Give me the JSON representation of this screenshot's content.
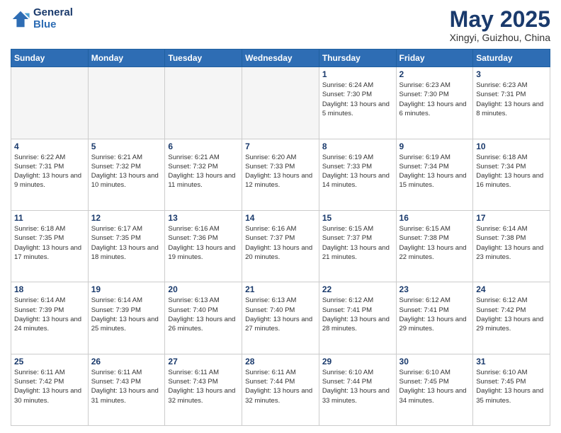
{
  "header": {
    "logo_line1": "General",
    "logo_line2": "Blue",
    "month_year": "May 2025",
    "location": "Xingyi, Guizhou, China"
  },
  "days_of_week": [
    "Sunday",
    "Monday",
    "Tuesday",
    "Wednesday",
    "Thursday",
    "Friday",
    "Saturday"
  ],
  "weeks": [
    [
      {
        "day": "",
        "empty": true
      },
      {
        "day": "",
        "empty": true
      },
      {
        "day": "",
        "empty": true
      },
      {
        "day": "",
        "empty": true
      },
      {
        "day": "1",
        "sunrise": "6:24 AM",
        "sunset": "7:30 PM",
        "daylight": "13 hours and 5 minutes."
      },
      {
        "day": "2",
        "sunrise": "6:23 AM",
        "sunset": "7:30 PM",
        "daylight": "13 hours and 6 minutes."
      },
      {
        "day": "3",
        "sunrise": "6:23 AM",
        "sunset": "7:31 PM",
        "daylight": "13 hours and 8 minutes."
      }
    ],
    [
      {
        "day": "4",
        "sunrise": "6:22 AM",
        "sunset": "7:31 PM",
        "daylight": "13 hours and 9 minutes."
      },
      {
        "day": "5",
        "sunrise": "6:21 AM",
        "sunset": "7:32 PM",
        "daylight": "13 hours and 10 minutes."
      },
      {
        "day": "6",
        "sunrise": "6:21 AM",
        "sunset": "7:32 PM",
        "daylight": "13 hours and 11 minutes."
      },
      {
        "day": "7",
        "sunrise": "6:20 AM",
        "sunset": "7:33 PM",
        "daylight": "13 hours and 12 minutes."
      },
      {
        "day": "8",
        "sunrise": "6:19 AM",
        "sunset": "7:33 PM",
        "daylight": "13 hours and 14 minutes."
      },
      {
        "day": "9",
        "sunrise": "6:19 AM",
        "sunset": "7:34 PM",
        "daylight": "13 hours and 15 minutes."
      },
      {
        "day": "10",
        "sunrise": "6:18 AM",
        "sunset": "7:34 PM",
        "daylight": "13 hours and 16 minutes."
      }
    ],
    [
      {
        "day": "11",
        "sunrise": "6:18 AM",
        "sunset": "7:35 PM",
        "daylight": "13 hours and 17 minutes."
      },
      {
        "day": "12",
        "sunrise": "6:17 AM",
        "sunset": "7:35 PM",
        "daylight": "13 hours and 18 minutes."
      },
      {
        "day": "13",
        "sunrise": "6:16 AM",
        "sunset": "7:36 PM",
        "daylight": "13 hours and 19 minutes."
      },
      {
        "day": "14",
        "sunrise": "6:16 AM",
        "sunset": "7:37 PM",
        "daylight": "13 hours and 20 minutes."
      },
      {
        "day": "15",
        "sunrise": "6:15 AM",
        "sunset": "7:37 PM",
        "daylight": "13 hours and 21 minutes."
      },
      {
        "day": "16",
        "sunrise": "6:15 AM",
        "sunset": "7:38 PM",
        "daylight": "13 hours and 22 minutes."
      },
      {
        "day": "17",
        "sunrise": "6:14 AM",
        "sunset": "7:38 PM",
        "daylight": "13 hours and 23 minutes."
      }
    ],
    [
      {
        "day": "18",
        "sunrise": "6:14 AM",
        "sunset": "7:39 PM",
        "daylight": "13 hours and 24 minutes."
      },
      {
        "day": "19",
        "sunrise": "6:14 AM",
        "sunset": "7:39 PM",
        "daylight": "13 hours and 25 minutes."
      },
      {
        "day": "20",
        "sunrise": "6:13 AM",
        "sunset": "7:40 PM",
        "daylight": "13 hours and 26 minutes."
      },
      {
        "day": "21",
        "sunrise": "6:13 AM",
        "sunset": "7:40 PM",
        "daylight": "13 hours and 27 minutes."
      },
      {
        "day": "22",
        "sunrise": "6:12 AM",
        "sunset": "7:41 PM",
        "daylight": "13 hours and 28 minutes."
      },
      {
        "day": "23",
        "sunrise": "6:12 AM",
        "sunset": "7:41 PM",
        "daylight": "13 hours and 29 minutes."
      },
      {
        "day": "24",
        "sunrise": "6:12 AM",
        "sunset": "7:42 PM",
        "daylight": "13 hours and 29 minutes."
      }
    ],
    [
      {
        "day": "25",
        "sunrise": "6:11 AM",
        "sunset": "7:42 PM",
        "daylight": "13 hours and 30 minutes."
      },
      {
        "day": "26",
        "sunrise": "6:11 AM",
        "sunset": "7:43 PM",
        "daylight": "13 hours and 31 minutes."
      },
      {
        "day": "27",
        "sunrise": "6:11 AM",
        "sunset": "7:43 PM",
        "daylight": "13 hours and 32 minutes."
      },
      {
        "day": "28",
        "sunrise": "6:11 AM",
        "sunset": "7:44 PM",
        "daylight": "13 hours and 32 minutes."
      },
      {
        "day": "29",
        "sunrise": "6:10 AM",
        "sunset": "7:44 PM",
        "daylight": "13 hours and 33 minutes."
      },
      {
        "day": "30",
        "sunrise": "6:10 AM",
        "sunset": "7:45 PM",
        "daylight": "13 hours and 34 minutes."
      },
      {
        "day": "31",
        "sunrise": "6:10 AM",
        "sunset": "7:45 PM",
        "daylight": "13 hours and 35 minutes."
      }
    ]
  ]
}
